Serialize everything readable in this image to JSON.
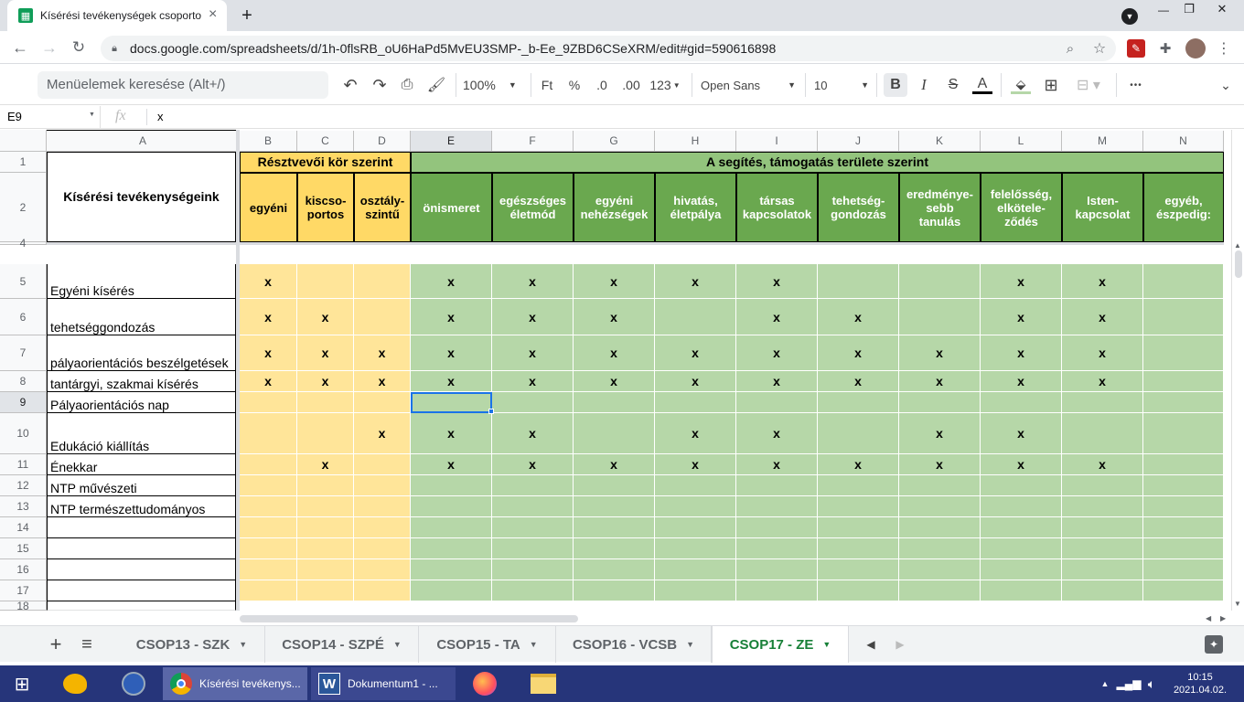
{
  "browser": {
    "tab_title": "Kísérési tevékenységek csoporto",
    "tab_close": "×",
    "new_tab": "+",
    "url": "docs.google.com/spreadsheets/d/1h-0flsRB_oU6HaPd5MvEU3SMP-_b-Ee_9ZBD6CSeXRM/edit#gid=590616898",
    "win_min": "—",
    "win_max": "❐",
    "win_close": "✕"
  },
  "toolbar": {
    "menu_search": "Menüelemek keresése (Alt+/)",
    "zoom": "100%",
    "currency": "Ft",
    "percent": "%",
    "dec_decrease": ".0",
    "dec_increase": ".00",
    "number_format": "123",
    "font": "Open Sans",
    "font_size": "10",
    "bold": "B",
    "italic": "I",
    "strike": "S",
    "text_color": "A",
    "more": "•••"
  },
  "formula_bar": {
    "cell_ref": "E9",
    "fx": "fx",
    "value": "x"
  },
  "sheet": {
    "columns": [
      "A",
      "B",
      "C",
      "D",
      "E",
      "F",
      "G",
      "H",
      "I",
      "J",
      "K",
      "L",
      "M",
      "N"
    ],
    "row_numbers": [
      "1",
      "2",
      "4",
      "5",
      "6",
      "7",
      "8",
      "9",
      "10",
      "11",
      "12",
      "13",
      "14",
      "15",
      "16",
      "17",
      "18"
    ],
    "title_cell": "Kísérési tevékenységeink",
    "group1_title": "Résztvevői kör szerint",
    "group2_title": "A segítés, támogatás területe szerint",
    "group1_headers": [
      "egyéni",
      "kiscso-\nportos",
      "osztály-\nszintű"
    ],
    "group2_headers": [
      "önismeret",
      "egészséges\néletmód",
      "egyéni\nnehézségek",
      "hivatás,\néletpálya",
      "társas\nkapcsolatok",
      "tehetség-\ngondozás",
      "eredménye-\nsebb\ntanulás",
      "felelősség,\nelkötele-\nződés",
      "Isten-\nkapcsolat",
      "egyéb,\nészpedig:"
    ],
    "rows": [
      {
        "label": "Egyéni kísérés",
        "marks": [
          "x",
          "",
          "",
          "x",
          "x",
          "x",
          "x",
          "x",
          "",
          "",
          "x",
          "x",
          ""
        ]
      },
      {
        "label": "tehetséggondozás",
        "marks": [
          "x",
          "x",
          "",
          "x",
          "x",
          "x",
          "",
          "x",
          "x",
          "",
          "x",
          "x",
          ""
        ]
      },
      {
        "label": "pályaorientációs beszélgetések",
        "marks": [
          "x",
          "x",
          "x",
          "x",
          "x",
          "x",
          "x",
          "x",
          "x",
          "x",
          "x",
          "x",
          ""
        ]
      },
      {
        "label": "tantárgyi, szakmai kísérés",
        "marks": [
          "x",
          "x",
          "x",
          "x",
          "x",
          "x",
          "x",
          "x",
          "x",
          "x",
          "x",
          "x",
          ""
        ]
      },
      {
        "label": "Pályaorientációs nap",
        "marks": [
          "",
          "",
          "",
          "",
          "",
          "",
          "",
          "",
          "",
          "",
          "",
          "",
          ""
        ]
      },
      {
        "label": "Edukáció kiállítás",
        "marks": [
          "",
          "",
          "x",
          "x",
          "x",
          "",
          "x",
          "x",
          "",
          "x",
          "x",
          "",
          ""
        ]
      },
      {
        "label": "Énekkar",
        "marks": [
          "",
          "x",
          "",
          "x",
          "x",
          "x",
          "x",
          "x",
          "x",
          "x",
          "x",
          "x",
          ""
        ]
      },
      {
        "label": "NTP művészeti",
        "marks": [
          "",
          "",
          "",
          "",
          "",
          "",
          "",
          "",
          "",
          "",
          "",
          "",
          ""
        ]
      },
      {
        "label": "NTP természettudományos",
        "marks": [
          "",
          "",
          "",
          "",
          "",
          "",
          "",
          "",
          "",
          "",
          "",
          "",
          ""
        ]
      },
      {
        "label": "",
        "marks": [
          "",
          "",
          "",
          "",
          "",
          "",
          "",
          "",
          "",
          "",
          "",
          "",
          ""
        ]
      },
      {
        "label": "",
        "marks": [
          "",
          "",
          "",
          "",
          "",
          "",
          "",
          "",
          "",
          "",
          "",
          "",
          ""
        ]
      },
      {
        "label": "",
        "marks": [
          "",
          "",
          "",
          "",
          "",
          "",
          "",
          "",
          "",
          "",
          "",
          "",
          ""
        ]
      },
      {
        "label": "",
        "marks": [
          "",
          "",
          "",
          "",
          "",
          "",
          "",
          "",
          "",
          "",
          "",
          "",
          ""
        ]
      },
      {
        "label": "",
        "marks": [
          "",
          "",
          "",
          "",
          "",
          "",
          "",
          "",
          "",
          "",
          "",
          "",
          ""
        ]
      },
      {
        "label": "",
        "marks": [
          "",
          "",
          "",
          "",
          "",
          "",
          "",
          "",
          "",
          "",
          "",
          "",
          ""
        ]
      }
    ],
    "selected_cell": "E9"
  },
  "sheet_tabs": {
    "add": "+",
    "list": "≡",
    "tabs": [
      "CSOP13 - SZK",
      "CSOP14 - SZPÉ",
      "CSOP15 - TA",
      "CSOP16 - VCSB",
      "CSOP17 - ZE"
    ],
    "active": "CSOP17 - ZE"
  },
  "taskbar": {
    "chrome_label": "Kísérési tevékenys...",
    "word_label": "Dokumentum1 - ...",
    "time": "10:15",
    "date": "2021.04.02."
  },
  "colors": {
    "yellow": "#ffe599",
    "yellow_header": "#ffd966",
    "green": "#b6d7a8",
    "green_header": "#6aa84f",
    "green_title": "#93c47d",
    "sheets_green": "#188038",
    "selection": "#1a73e8"
  }
}
